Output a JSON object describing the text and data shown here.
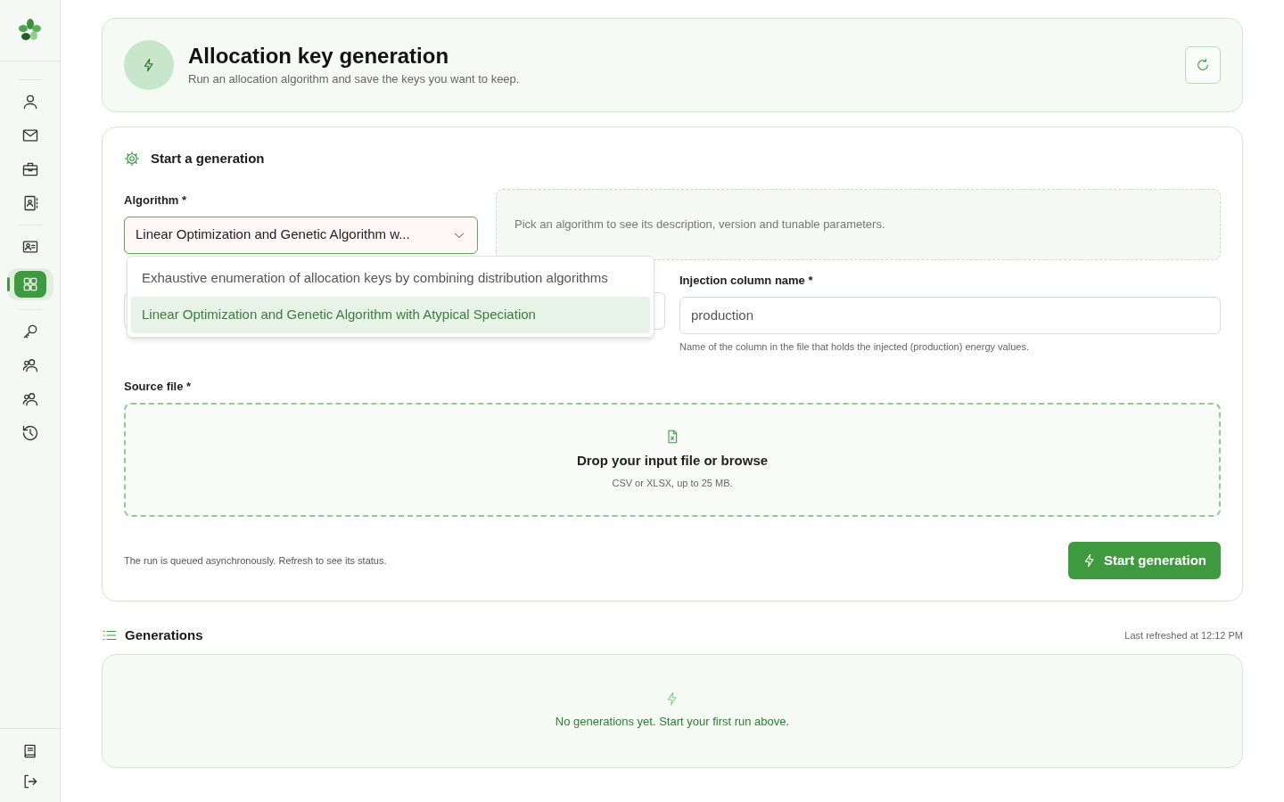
{
  "sidebar": {
    "groups": [
      [
        {
          "kind": "user",
          "selected": false
        },
        {
          "kind": "mail",
          "selected": false
        },
        {
          "kind": "briefcase",
          "selected": false
        },
        {
          "kind": "contacts",
          "selected": false
        }
      ],
      [
        {
          "kind": "idcard",
          "selected": false
        },
        {
          "kind": "grid",
          "selected": true
        }
      ],
      [
        {
          "kind": "key",
          "selected": false
        },
        {
          "kind": "users",
          "selected": false
        },
        {
          "kind": "users",
          "selected": false
        },
        {
          "kind": "history",
          "selected": false
        }
      ]
    ],
    "footer": [
      {
        "kind": "book"
      },
      {
        "kind": "logout"
      }
    ]
  },
  "header": {
    "title": "Allocation key generation",
    "subtitle": "Run an allocation algorithm and save the keys you want to keep."
  },
  "form": {
    "title": "Start a generation",
    "algorithm": {
      "label": "Algorithm *",
      "value": "Linear Optimization and Genetic Algorithm w...",
      "expanded": true,
      "options": [
        {
          "label": "Exhaustive enumeration of allocation keys by combining distribution algorithms",
          "selected": false
        },
        {
          "label": "Linear Optimization and Genetic Algorithm with Atypical Speciation",
          "selected": true
        }
      ]
    },
    "algorithm_info": "Pick an algorithm to see its description, version and tunable parameters.",
    "injection": {
      "label": "Injection column name *",
      "value": "production",
      "help": "Name of the column in the file that holds the injected (production) energy values."
    },
    "source": {
      "label": "Source file *",
      "title": "Drop your input file or browse",
      "hint": "CSV or XLSX, up to 25 MB."
    },
    "note": "The run is queued asynchronously. Refresh to see its status.",
    "submit": "Start generation"
  },
  "generations": {
    "title": "Generations",
    "refreshed": "Last refreshed at 12:12 PM",
    "empty": "No generations yet. Start your first run above."
  }
}
